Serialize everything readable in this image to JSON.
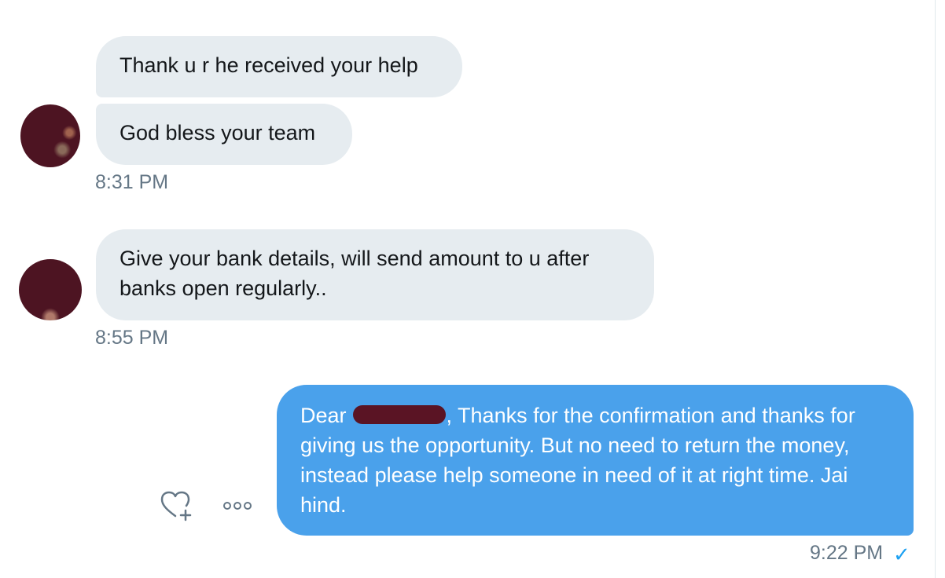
{
  "messages": [
    {
      "direction": "incoming",
      "bubbles": [
        "Thank u r he received your help",
        "God bless your team"
      ],
      "time": "8:31 PM"
    },
    {
      "direction": "incoming",
      "bubbles": [
        "Give your bank details, will send amount to u after banks open regularly.."
      ],
      "time": "8:55 PM"
    },
    {
      "direction": "outgoing",
      "greeting": "Dear",
      "body": ", Thanks for the confirmation and thanks for giving us the opportunity. But no need to return the money, instead please help someone in need of it at right time. Jai hind.",
      "time": "9:22 PM",
      "status": "✓"
    }
  ],
  "actions": {
    "like_icon": "heart-plus-icon",
    "more_icon": "more-options-icon"
  },
  "colors": {
    "incoming_bubble": "#e6ecf0",
    "outgoing_bubble": "#4aa1eb",
    "timestamp": "#657786",
    "check": "#1da1f2",
    "avatar": "#4d1422"
  }
}
